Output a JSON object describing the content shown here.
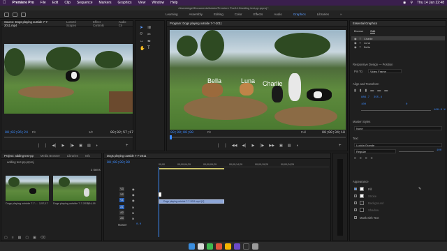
{
  "menubar": {
    "app": "Premiere Pro",
    "items": [
      "File",
      "Edit",
      "Clip",
      "Sequence",
      "Markers",
      "Graphics",
      "View",
      "Window",
      "Help"
    ],
    "clock": "Thu 14 Jan  22:48"
  },
  "path": "/Users/nigel/Documents/Adobe/Premiere Pro/14.0/adding text-pp.prproj *",
  "workspaces": {
    "tabs": [
      "Learning",
      "Assembly",
      "Editing",
      "Color",
      "Effects",
      "Audio",
      "Graphics",
      "Libraries"
    ],
    "active": "Graphics"
  },
  "source": {
    "tabs": [
      "Source: Dogs playing outside 7-7-2011.mp4",
      "Lumetri Scopes",
      "Effect Controls",
      "Audio Cli"
    ],
    "timecode_in": "00;02;06;24",
    "fit": "Fit",
    "ratio": "1/2",
    "timecode_out": "00;02;57;17"
  },
  "program": {
    "tabs": [
      "Program: Dogs playing outside 7-7-2011"
    ],
    "timecode_in": "00;00;00;00",
    "fit": "Fit",
    "ratio": "Full",
    "timecode_out": "00;00;34;18",
    "captions": [
      "Bella",
      "Luna",
      "Charlie"
    ]
  },
  "project": {
    "tabs": [
      "Project: adding text-pp",
      "Media Browser",
      "Libraries",
      "Info"
    ],
    "filename": "adding text-pp.prproj",
    "item_count": "2 Items",
    "items": [
      {
        "name": "Dogs playing outside 7-7-...",
        "dur": "2;57;17"
      },
      {
        "name": "Dogs playing outside 7-7-2011",
        "dur": "0;34;18"
      }
    ]
  },
  "timeline": {
    "tab": "Dogs playing outside 7-7-2011",
    "timecode": "00;00;00;00",
    "ruler": [
      "00;00",
      "00;00;04;29",
      "00;00;09;29",
      "00;00;14;29",
      "00;00;19;29",
      "00;00;24;29"
    ],
    "tracks": [
      "V3",
      "V2",
      "V1",
      "A1",
      "A2",
      "A3"
    ],
    "master": "Master",
    "master_val": "0.0",
    "clip_label": "Dogs playing outside 7-7-2011.mp4 [V]"
  },
  "essential_graphics": {
    "title": "Essential Graphics",
    "tabs": [
      "Browse",
      "Edit"
    ],
    "layers": [
      "Charlie",
      "Luna",
      "Bella"
    ],
    "responsive_design": "Responsive Design — Position",
    "pin_to_label": "Pin To:",
    "pin_to_value": "Video Frame",
    "align_title": "Align and Transform",
    "pos_x": "886.7",
    "pos_y": "355.4",
    "rot": "0",
    "scale": "100",
    "opacity": "100.0 %",
    "master_styles": "Master Styles",
    "style_value": "None",
    "text_title": "Text",
    "font": "Lucida Grande",
    "font_style": "Regular",
    "font_size": "100",
    "appearance_title": "Appearance",
    "appearance_items": [
      "Fill",
      "Stroke",
      "Background",
      "Shadow"
    ],
    "mask_label": "Mask with Text"
  },
  "colors": {
    "accent": "#3d8cff",
    "clip": "#8ea7d8",
    "menubar": "#3a1f4d"
  }
}
